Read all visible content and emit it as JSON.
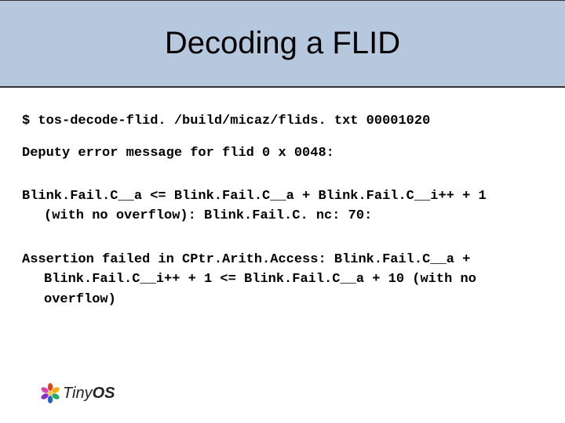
{
  "title": "Decoding a FLID",
  "lines": {
    "cmd": "$ tos-decode-flid. /build/micaz/flids. txt 00001020",
    "msg": "Deputy error message for flid 0 x 0048:",
    "block1_line1": "Blink.Fail.C__a <= Blink.Fail.C__a + Blink.Fail.C__i++ + 1",
    "block1_line2": "(with no overflow): Blink.Fail.C. nc: 70:",
    "block2_line1": "Assertion failed in CPtr.Arith.Access: Blink.Fail.C__a +",
    "block2_line2": "Blink.Fail.C__i++ + 1 <= Blink.Fail.C__a + 10 (with no",
    "block2_line3": "overflow)"
  },
  "logo": {
    "tiny": "Tiny",
    "os": "OS"
  }
}
